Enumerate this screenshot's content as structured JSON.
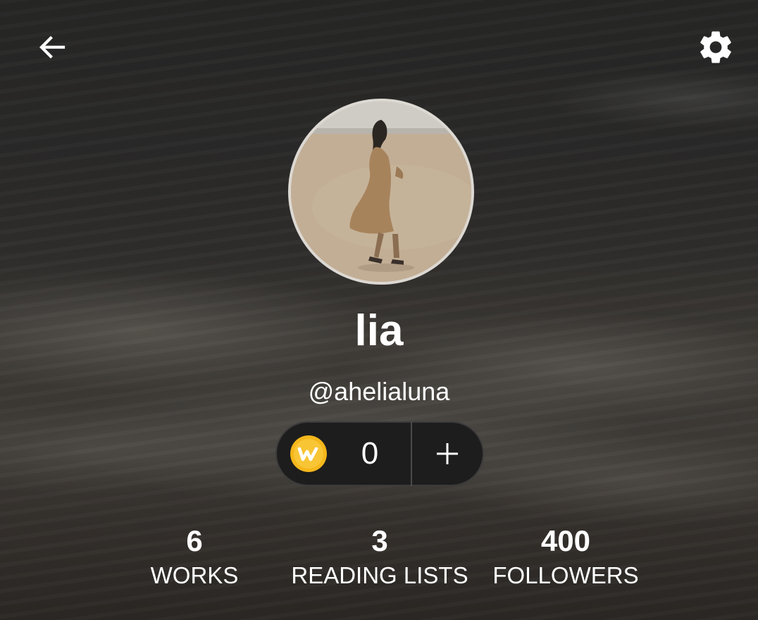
{
  "profile": {
    "display_name": "lia",
    "username": "@ahelialuna"
  },
  "coins": {
    "count": "0",
    "add_label": "+"
  },
  "stats": [
    {
      "value": "6",
      "label": "WORKS"
    },
    {
      "value": "3",
      "label": "READING LISTS"
    },
    {
      "value": "400",
      "label": "FOLLOWERS"
    }
  ],
  "icons": {
    "back": "back-arrow-icon",
    "settings": "gear-icon",
    "coin": "coin-icon",
    "add": "plus-icon"
  },
  "colors": {
    "coin_gold": "#f5b71b",
    "pill_bg": "#1d1d1d",
    "text": "#ffffff"
  }
}
